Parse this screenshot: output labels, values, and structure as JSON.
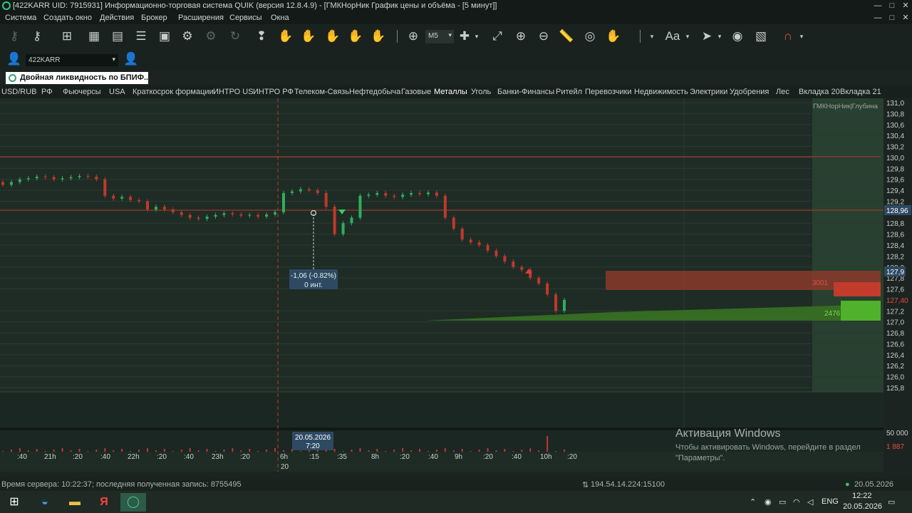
{
  "window": {
    "title": "[422KARR UID: 7915931] Информационно-торговая система QUIK (версия 12.8.4.9) - [ГМКНорНик График цены и объёма - [5 минут]]",
    "minimize": "—",
    "maximize": "□",
    "close": "✕"
  },
  "menu": [
    "Система",
    "Создать окно",
    "Действия",
    "Брокер",
    "Расширения",
    "Сервисы",
    "Окна"
  ],
  "toolbar": {
    "timeframe": "M5",
    "font_label": "Aa"
  },
  "account": {
    "value": "422KARR"
  },
  "window_label": "Двойная ликвидность по  БПИФ...",
  "tabs": [
    "USD/RUB",
    "РФ",
    "Фьючерсы",
    "USA",
    "Краткосрок формации",
    "ИНТРО US",
    "ИНТРО РФ",
    "Телеком-Связь",
    "Нефтедобыча",
    "Газовые",
    "Металлы",
    "Уголь",
    "Банки-Финансы",
    "Ритейл",
    "Перевозчики",
    "Недвижимость",
    "Электрики",
    "Удобрения",
    "Лес",
    "Вкладка 20",
    "Вкладка 21"
  ],
  "active_tab": "Металлы",
  "chart": {
    "depth_header": "ГМКНорНик|Глубина",
    "price_ticks": [
      "131,0",
      "130,8",
      "130,6",
      "130,4",
      "130,2",
      "130,0",
      "129,8",
      "129,6",
      "129,4",
      "129,2",
      "128,96",
      "128,8",
      "128,6",
      "128,4",
      "128,2",
      "128,0",
      "127,9",
      "127,8",
      "127,6",
      "127,40",
      "127,2",
      "127,0",
      "126,8",
      "126,6",
      "126,4",
      "126,2",
      "126,0",
      "125,8"
    ],
    "current_price_label": "128,96",
    "ask_label": "127,9",
    "bid_label": "127,40",
    "ask_volume": "3001",
    "bid_volume": "2476",
    "measure_label_line1": "-1,06 (-0.82%)",
    "measure_label_line2": "0 инт.",
    "volume_scale_top": "50 000",
    "volume_scale_val": "1 887",
    "cursor_date": "20.05.2026",
    "cursor_time": "7:20",
    "time_ticks": [
      ":40",
      "21h",
      ":20",
      ":40",
      "22h",
      ":20",
      ":40",
      "23h",
      ":20",
      "6h",
      ":15",
      ":35",
      "8h",
      ":20",
      ":40",
      "9h",
      ":20",
      ":40",
      "10h",
      ":20"
    ],
    "time_day": "20",
    "colors": {
      "up": "#2fae5b",
      "down": "#c0392b",
      "level": "#c0392b",
      "ask_bar": "#a83d2e",
      "bid_bar": "#3c9a28"
    }
  },
  "chart_data": {
    "type": "candlestick",
    "instrument": "ГМКНорНик",
    "interval": "5 минут",
    "ylim": [
      125.8,
      131.0
    ],
    "horizontal_levels": [
      130.0,
      128.96
    ],
    "last_price": 128.96,
    "best_ask": 127.9,
    "best_bid": 127.4,
    "ask_volume": 3001,
    "bid_volume": 2476,
    "measured_change": "-1,06 (-0.82%)",
    "approx_closes": [
      129.5,
      129.55,
      129.6,
      129.62,
      129.65,
      129.64,
      129.6,
      129.62,
      129.64,
      129.66,
      129.65,
      129.6,
      129.3,
      129.25,
      129.28,
      129.22,
      129.2,
      129.05,
      129.1,
      129.05,
      129.0,
      128.95,
      128.9,
      128.88,
      128.92,
      128.95,
      128.98,
      128.96,
      128.94,
      128.95,
      128.92,
      128.96,
      129.0,
      129.35,
      129.38,
      129.42,
      129.4,
      129.35,
      129.1,
      128.6,
      128.8,
      128.9,
      129.3,
      129.32,
      129.35,
      129.3,
      129.28,
      129.32,
      129.35,
      129.33,
      129.36,
      129.3,
      128.9,
      128.7,
      128.5,
      128.45,
      128.4,
      128.3,
      128.2,
      128.1,
      128.0,
      127.95,
      127.8,
      127.7,
      127.5,
      127.2,
      127.4
    ]
  },
  "status": {
    "left": "Время сервера: 10:22:37; последняя полученная запись: 8755495",
    "connection": "194.54.14.224:15100",
    "date": "20.05.2026"
  },
  "activation": {
    "title": "Активация Windows",
    "line1": "Чтобы активировать Windows, перейдите в раздел",
    "line2": "\"Параметры\"."
  },
  "taskbar": {
    "lang": "ENG",
    "time": "12:22",
    "date": "20.05.2026"
  }
}
